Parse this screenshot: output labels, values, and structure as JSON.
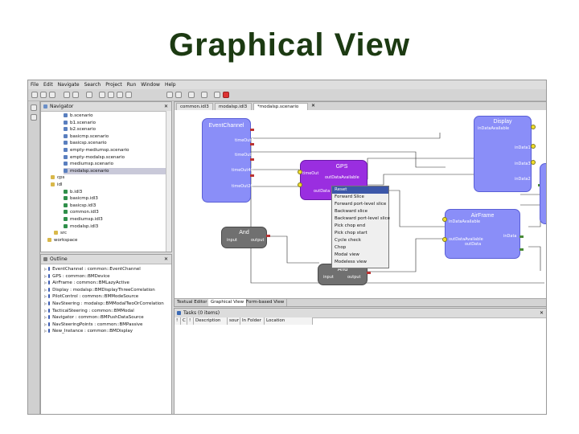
{
  "slide_title": "Graphical View",
  "menu": [
    "File",
    "Edit",
    "Navigate",
    "Search",
    "Project",
    "Run",
    "Window",
    "Help"
  ],
  "navigator": {
    "title": "Navigator",
    "items": [
      {
        "label": "b.scenario",
        "icon": "scenario-file-icon"
      },
      {
        "label": "b1.scenario",
        "icon": "scenario-file-icon"
      },
      {
        "label": "b2.scenario",
        "icon": "scenario-file-icon"
      },
      {
        "label": "basicmp.scenario",
        "icon": "scenario-file-icon"
      },
      {
        "label": "basicsp.scenario",
        "icon": "scenario-file-icon"
      },
      {
        "label": "empty-mediumsp.scenario",
        "icon": "scenario-file-icon"
      },
      {
        "label": "empty-modalsp.scenario",
        "icon": "scenario-file-icon"
      },
      {
        "label": "mediumsp.scenario",
        "icon": "scenario-file-icon"
      },
      {
        "label": "modalsp.scenario",
        "icon": "scenario-file-icon"
      },
      {
        "label": "cps",
        "icon": "folder-icon"
      },
      {
        "label": "idl",
        "icon": "folder-icon"
      },
      {
        "label": "b.idl3",
        "icon": "idl-file-icon"
      },
      {
        "label": "basicmp.idl3",
        "icon": "idl-file-icon"
      },
      {
        "label": "basicsp.idl3",
        "icon": "idl-file-icon"
      },
      {
        "label": "common.idl3",
        "icon": "idl-file-icon"
      },
      {
        "label": "mediumsp.idl3",
        "icon": "idl-file-icon"
      },
      {
        "label": "modalsp.idl3",
        "icon": "idl-file-icon"
      },
      {
        "label": "src",
        "icon": "folder-icon"
      },
      {
        "label": "workspace",
        "icon": "folder-icon"
      }
    ],
    "selected": "modalsp.scenario"
  },
  "outline": {
    "title": "Outline",
    "items": [
      "EventChannel : common::EventChannel",
      "GPS : common::BMDevice",
      "AirFrame : common::BMLazyActive",
      "Display : modalsp::BMDisplayThreeCorrelation",
      "PilotControl : common::BMModeSource",
      "NavSteering : modalsp::BMModalTwoOrCorrelation",
      "TacticalSteering : common::BMModal",
      "Navigator : common::BMPushDataSource",
      "NavSteeringPoints : common::BMPassive",
      "New_Instance : common::BMDisplay"
    ]
  },
  "editor_tabs": [
    "common.idl3",
    "modalsp.idl3",
    "*modalsp.scenario"
  ],
  "bottom_tabs": [
    "Textual Editor",
    "Graphical View",
    "Form-based View"
  ],
  "diagram": {
    "event_channel": {
      "title": "EventChannel",
      "ports": [
        "timeOut5",
        "timeOut1",
        "timeOut40",
        "timeOut20"
      ]
    },
    "gps": {
      "title": "GPS",
      "ports": [
        "timeOut",
        "outDataAvailable",
        "outData"
      ]
    },
    "display": {
      "title": "Display",
      "ports": [
        "inDataAvailable",
        "inData1",
        "inData3",
        "inData2"
      ]
    },
    "and1": {
      "title": "And",
      "ports": [
        "input",
        "output"
      ]
    },
    "and2": {
      "title": "And",
      "ports": [
        "input",
        "output"
      ]
    },
    "airframe": {
      "title": "AirFrame",
      "ports": [
        "inDataAvailable",
        "inData",
        "outDataAvailable",
        "outData"
      ]
    }
  },
  "context_menu": {
    "items": [
      "Reset",
      "Forward Slice",
      "Forward port-level slice",
      "Backward slice",
      "Backward port-level slice",
      "Pick chop end",
      "Pick chop start",
      "Cycle check",
      "Chop",
      "Modal view",
      "Modeless view"
    ],
    "highlighted": "Reset"
  },
  "tasks": {
    "title": "Tasks (0 items)",
    "columns": [
      "!",
      "C",
      "!",
      "Description",
      "sour",
      "In Folder",
      "Location"
    ]
  },
  "colors": {
    "node_fill": "#8a8ef8",
    "node_border": "#5a5fd6",
    "gps_fill": "#9a2ee0",
    "and_fill": "#707070",
    "highlight": "#3c57a8",
    "title_green": "#1c3a12"
  }
}
